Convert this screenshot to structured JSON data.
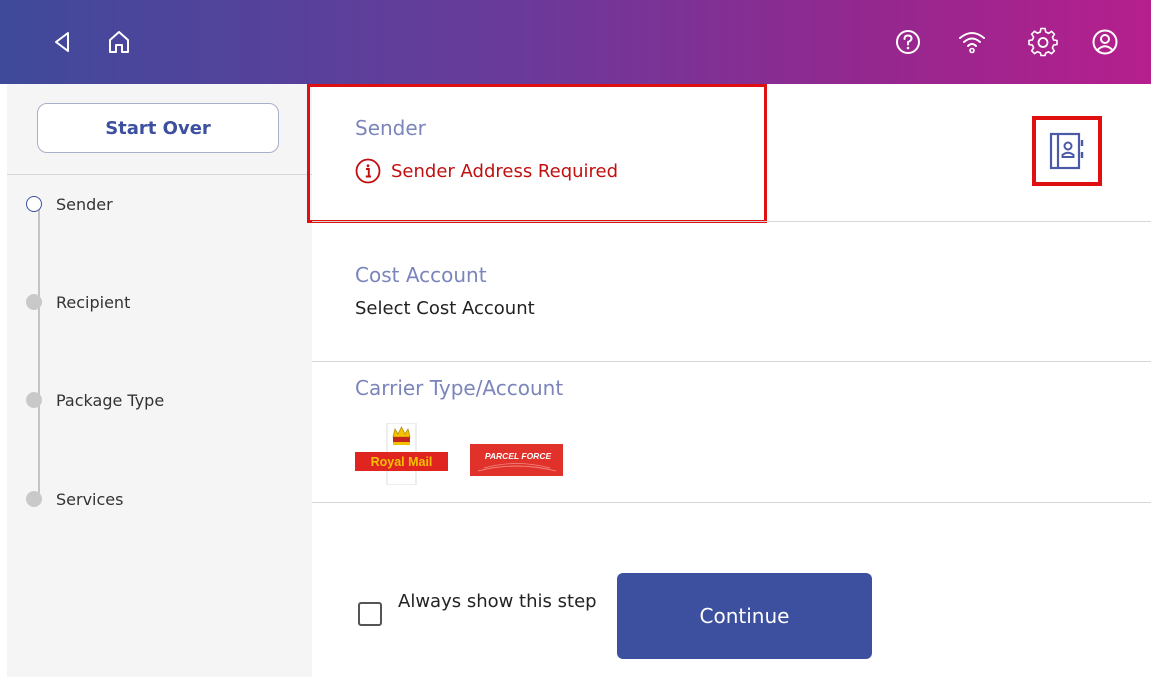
{
  "topbar": {
    "icons": [
      "back-icon",
      "home-icon",
      "help-icon",
      "wifi-icon",
      "settings-icon",
      "account-icon"
    ]
  },
  "sidebar": {
    "start_over_label": "Start Over",
    "steps": [
      {
        "label": "Sender",
        "state": "current"
      },
      {
        "label": "Recipient",
        "state": "pending"
      },
      {
        "label": "Package Type",
        "state": "pending"
      },
      {
        "label": "Services",
        "state": "pending"
      }
    ]
  },
  "main": {
    "sender": {
      "label": "Sender",
      "error": "Sender Address Required",
      "address_book_icon": "address-book-icon"
    },
    "cost_account": {
      "label": "Cost Account",
      "value": "Select Cost Account"
    },
    "carrier": {
      "label": "Carrier Type/Account",
      "royal_mail_text": "Royal Mail",
      "parcelforce_text": "PARCEL FORCE"
    },
    "always_show_label": "Always show this step",
    "always_show_checked": false,
    "continue_label": "Continue"
  },
  "colors": {
    "accent": "#3d4f9f",
    "error": "#c10f0f",
    "highlight_border": "#e01010",
    "label": "#7b85bb"
  }
}
